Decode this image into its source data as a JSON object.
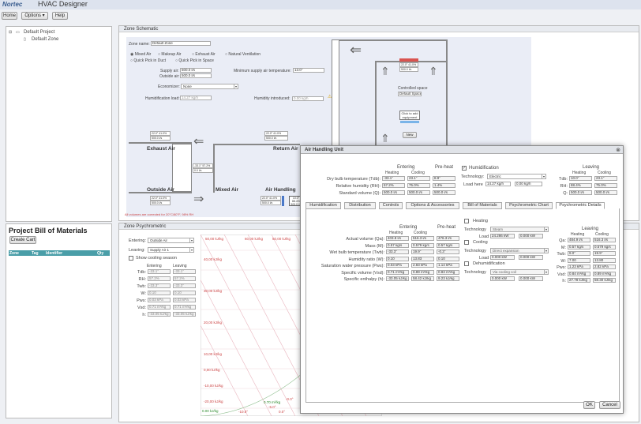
{
  "app": {
    "logo": "Nortec",
    "title": "HVAC Designer"
  },
  "menu": [
    "Home",
    "Options ▾",
    "Help"
  ],
  "tree": {
    "project": "Default Project",
    "zone": "Default Zone"
  },
  "bom": {
    "title": "Project Bill of Materials",
    "create": "Create Cart",
    "cols": [
      "Zone",
      "Tag",
      "Identifier",
      "Qty"
    ]
  },
  "zs": {
    "header": "Zone Schematic",
    "zone_name_label": "Zone name:",
    "zone_name": "Default Zone",
    "radios": [
      "Mixed Air",
      "Makeup Air",
      "Exhaust Air",
      "Natural Ventilation",
      "Quick Pick in Duct",
      "Quick Pick in Space"
    ],
    "supply_label": "Supply air:",
    "supply": "500.0 l/s",
    "outside_label": "Outside air:",
    "outside": "500.0 l/s",
    "min_supply_label": "Minimum supply air temperature:",
    "min_supply": "13.0°",
    "economizer_label": "Economizer:",
    "economizer": "None",
    "humload_label": "Humidification load:",
    "humload": "14.27 kg/h",
    "humintro_label": "Humidity introduced:",
    "humintro": "0.00 kg/h",
    "exhaust": "Exhaust Air",
    "return": "Return Air",
    "outside_air": "Outside Air",
    "mixed": "Mixed Air",
    "ahu": "Air Handling",
    "space1": "Controlled space",
    "space2": "Default Space",
    "equip": "Click to add equipment",
    "new": "New",
    "tag1": "22.0° 41.0%",
    "tag1b": "500.0 l/s",
    "tag2": "22.0° 41.0%",
    "tag2b": "500.0 l/s",
    "tag3": "22.0° 41.0%",
    "tag3b": "500.0 l/s",
    "tag4": "-33.1° 57.2%",
    "tag4b": "0.0 l/s",
    "tag5": "22.0° 41.0%",
    "tag5b": "500.0 l/s",
    "tag6": "10.0° 88.4%",
    "tag6b": "500.0 l/s",
    "tag7": "22.0° 41.0%",
    "tag7b": "500.0 l/s",
    "note": "All volumes are corrected for 20°C/80°F, 98% RH"
  },
  "zp": {
    "header": "Zone Psychrometric",
    "entering_label": "Entering:",
    "entering": "Outside Air",
    "leaving_label": "Leaving:",
    "leaving": "Supply Air 1",
    "season": "Show cooling season",
    "col_e": "Entering",
    "col_l": "Leaving",
    "rows": [
      [
        "Tdb:",
        "-33.1°",
        "-33.1°"
      ],
      [
        "RH:",
        "57.2%",
        "57.2%"
      ],
      [
        "Twb:",
        "-33.3°",
        "-33.3°"
      ],
      [
        "W:",
        "0.10",
        "0.10"
      ],
      [
        "Pws:",
        "0.03 kPa",
        "0.03 kPa"
      ],
      [
        "Vsd:",
        "0.71 m³/kg",
        "0.71 m³/kg"
      ],
      [
        "h:",
        "-33.05 kJ/kg",
        "-33.05 kJ/kg"
      ]
    ],
    "enth": [
      "50,00 kJ/kg",
      "60,00 kJ/kg",
      "50,00 kJ/kg",
      "40,00 kJ/kg",
      "30,00 kJ/kg",
      "20,00 kJ/kg",
      "10,00 kJ/kg",
      "0,00 kJ/kg",
      "-10,00 kJ/kg",
      "-20,00 kJ/kg"
    ],
    "bottom": [
      "0.00 kJ/kg",
      "-10.0°",
      "0.0°",
      "0.70 m³/kg",
      "-5.0°",
      "-0.0°"
    ]
  },
  "ahu": {
    "title": "Air Handling Unit",
    "entering": "Entering",
    "preheat": "Pre-heat",
    "heating": "Heating",
    "cooling": "Cooling",
    "leaving": "Leaving",
    "top_rows": [
      {
        "l": "Dry bulb temperature (Tdb):",
        "h": "-33.1°",
        "c": "23.1°",
        "p": "8.9°"
      },
      {
        "l": "Relative humidity (RH):",
        "h": "57.2%",
        "c": "75.0%",
        "p": "1.4%"
      },
      {
        "l": "Standard volume (Q):",
        "h": "500.0 l/s",
        "c": "500.0 l/s",
        "p": "500.0 l/s"
      }
    ],
    "humid": "Humidification",
    "tech": "Technology:",
    "tech_val": "Electric",
    "load_here": "Load here",
    "load1": "14.27 kg/h",
    "load2": "0.00 kg/h",
    "leave_top": [
      {
        "l": "Tdb:",
        "h": "10.0°",
        "c": "23.1°"
      },
      {
        "l": "RH:",
        "h": "88.4%",
        "c": "75.0%"
      },
      {
        "l": "Q:",
        "h": "500.0 l/s",
        "c": "500.0 l/s"
      }
    ],
    "tabs": [
      "Humidification",
      "Distribution",
      "Controls",
      "Options & Accessories",
      "Bill of Materials",
      "Psychrometric Chart",
      "Psychrometric Details"
    ],
    "det_rows": [
      {
        "l": "Actual volume (Qa):",
        "h": "403.8 l/s",
        "c": "516.3 l/s",
        "p": "476.3 l/s"
      },
      {
        "l": "Mass (M):",
        "h": "0.57 kg/s",
        "c": "0.579 kg/s",
        "p": "0.57 kg/s"
      },
      {
        "l": "Wet bulb temperature (Twb):",
        "h": "-33.3°",
        "c": "19.9°",
        "p": "-0.3°"
      },
      {
        "l": "Humidity ratio (W):",
        "h": "0.10",
        "c": "13.83",
        "p": "0.10"
      },
      {
        "l": "Saturation water pressure (Pws):",
        "h": "0.03 kPa",
        "c": "2.83 kPa",
        "p": "1.14 kPa"
      },
      {
        "l": "Specific volume (Vsd):",
        "h": "0.71 m³/kg",
        "c": "0.89 m³/kg",
        "p": "0.83 m³/kg"
      },
      {
        "l": "Specific enthalpy (h):",
        "h": "-33.05 kJ/kg",
        "c": "58.42 kJ/kg",
        "p": "9.23 kJ/kg"
      }
    ],
    "heating_lbl": "Heating",
    "cooling_lbl": "Cooling",
    "dehum_lbl": "Dehumidification",
    "technology": "Technology",
    "load": "Load",
    "heat_tech": "Steam",
    "heat_load": "24.286 kW",
    "heat_load2": "0.000 kW",
    "cool_tech": "Direct expansion",
    "cool_load": "0.000 kW",
    "cool_load2": "0.000 kW",
    "dehum_tech": "Via cooling coil",
    "dehum_v1": "0.000 kW",
    "dehum_v2": "0.000 kW",
    "leave_det": [
      {
        "l": "Qa:",
        "h": "484.9 l/s",
        "c": "516.3 l/s"
      },
      {
        "l": "M:",
        "h": "0.57 kg/s",
        "c": "0.579 kg/s"
      },
      {
        "l": "Twb:",
        "h": "9.0°",
        "c": "19.9°"
      },
      {
        "l": "W:",
        "h": "7.00",
        "c": "13.80"
      },
      {
        "l": "Pws:",
        "h": "1.23 kPa",
        "c": "2.82 kPa"
      },
      {
        "l": "Vsd:",
        "h": "0.84 m³/kg",
        "c": "0.89 m³/kg"
      },
      {
        "l": "h:",
        "h": "27.78 kJ/kg",
        "c": "58.30 kJ/kg"
      }
    ],
    "ok": "OK",
    "cancel": "Cancel"
  },
  "colors": {
    "accent": "#3a5d8f",
    "table_head": "#4a9ea8",
    "pink": "#e8a0a8"
  }
}
